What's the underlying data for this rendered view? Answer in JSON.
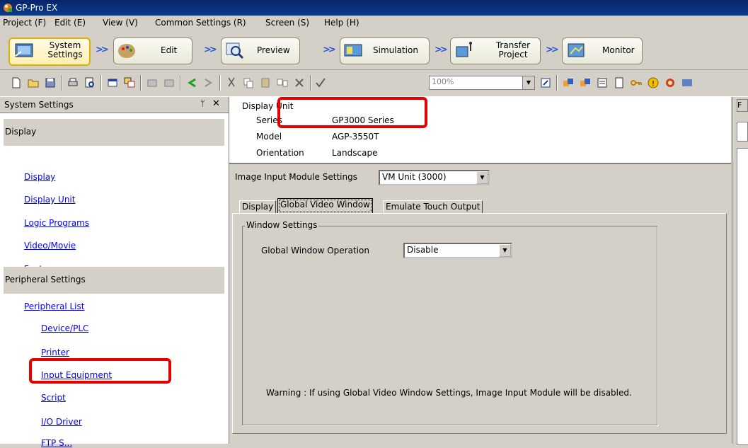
{
  "window": {
    "title": "GP-Pro EX"
  },
  "menu": [
    "Project (F)",
    "Edit (E)",
    "View (V)",
    "Common Settings (R)",
    "Screen (S)",
    "Help (H)"
  ],
  "workflow": {
    "system_settings": "System\nSettings",
    "edit": "Edit",
    "preview": "Preview",
    "simulation": "Simulation",
    "transfer": "Transfer\nProject",
    "monitor": "Monitor"
  },
  "toolbar": {
    "zoom": "100%"
  },
  "left_panel": {
    "title": "System Settings",
    "pin": "ᛘ",
    "close": "✕",
    "display_group": "Display",
    "display_links": [
      "Display",
      "Display Unit",
      "Logic Programs",
      "Video/Movie",
      "Font"
    ],
    "peripheral_group": "Peripheral Settings",
    "peripheral_list": "Peripheral List",
    "peripheral_links": [
      "Device/PLC",
      "Printer",
      "Input Equipment",
      "Script",
      "I/O Driver",
      "FTP S..."
    ]
  },
  "display_unit": {
    "header": "Display Unit",
    "series_label": "Series",
    "series_value": "GP3000 Series",
    "model_label": "Model",
    "model_value": "AGP-3550T",
    "orientation_label": "Orientation",
    "orientation_value": "Landscape"
  },
  "image_input": {
    "label": "Image Input Module Settings",
    "value": "VM Unit (3000)"
  },
  "tabs": [
    "Display",
    "Global Video Window",
    "Emulate Touch Output"
  ],
  "window_settings": {
    "legend": "Window Settings",
    "operation_label": "Global Window Operation",
    "operation_value": "Disable",
    "warning": "Warning : If using Global Video Window Settings, Image Input Module will be disabled."
  },
  "colors": {
    "highlight": "#e60000",
    "link": "#0000ff"
  }
}
